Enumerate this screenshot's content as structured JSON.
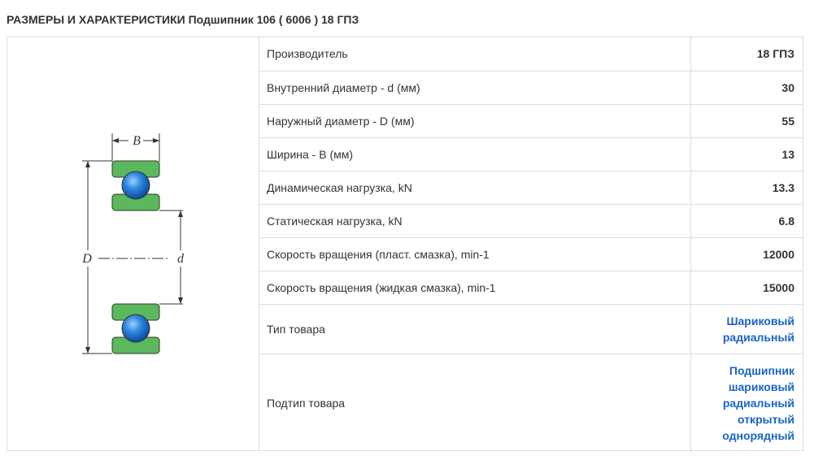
{
  "page": {
    "title": "РАЗМЕРЫ И ХАРАКТЕРИСТИКИ Подшипник 106 ( 6006 ) 18 ГПЗ"
  },
  "drawing": {
    "label_B": "B",
    "label_D": "D",
    "label_d": "d",
    "colors": {
      "ring": "#5cb85c",
      "ball": "#1e73c8",
      "line": "#333333"
    }
  },
  "specs": [
    {
      "label": "Производитель",
      "value": "18 ГПЗ"
    },
    {
      "label": "Внутренний диаметр - d (мм)",
      "value": "30"
    },
    {
      "label": "Наружный диаметр - D (мм)",
      "value": "55"
    },
    {
      "label": "Ширина - B (мм)",
      "value": "13"
    },
    {
      "label": "Динамическая нагрузка, kN",
      "value": "13.3"
    },
    {
      "label": "Статическая нагрузка, kN",
      "value": "6.8"
    },
    {
      "label": "Скорость вращения (пласт. смазка), min-1",
      "value": "12000"
    },
    {
      "label": "Скорость вращения (жидкая смазка), min-1",
      "value": "15000"
    },
    {
      "label": "Тип товара",
      "value_lines": [
        "Шариковый",
        "радиальный"
      ]
    },
    {
      "label": "Подтип товара",
      "value_lines": [
        "Подшипник",
        "шариковый",
        "радиальный",
        "открытый",
        "однорядный"
      ]
    }
  ],
  "link_color": "#1a64c8"
}
